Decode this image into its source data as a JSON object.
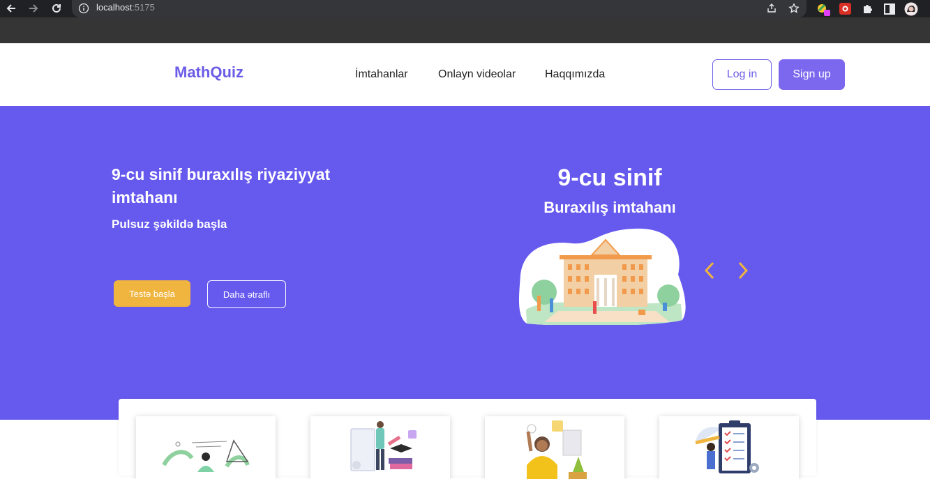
{
  "browser": {
    "url_host": "localhost",
    "url_port": ":5175",
    "icons": [
      "back-arrow-icon",
      "forward-arrow-icon",
      "reload-icon",
      "info-icon",
      "share-icon",
      "star-icon",
      "extension-color-icon",
      "extension-red-icon",
      "puzzle-icon",
      "sidepanel-icon",
      "profile-avatar"
    ]
  },
  "header": {
    "logo": "MathQuiz",
    "nav": [
      "İmtahanlar",
      "Onlayn videolar",
      "Haqqımızda"
    ],
    "login_label": "Log in",
    "signup_label": "Sign up"
  },
  "hero": {
    "title": "9-cu sinif buraxılış riyaziyyat imtahanı",
    "subtitle": "Pulsuz şəkildə başla",
    "start_label": "Testə başla",
    "more_label": "Daha ətraflı",
    "slide": {
      "title": "9-cu sinif",
      "subtitle": "Buraxılış imtahanı"
    }
  },
  "colors": {
    "brand": "#6b5ce7",
    "hero_bg": "#6659ee",
    "accent": "#f0b53f"
  }
}
